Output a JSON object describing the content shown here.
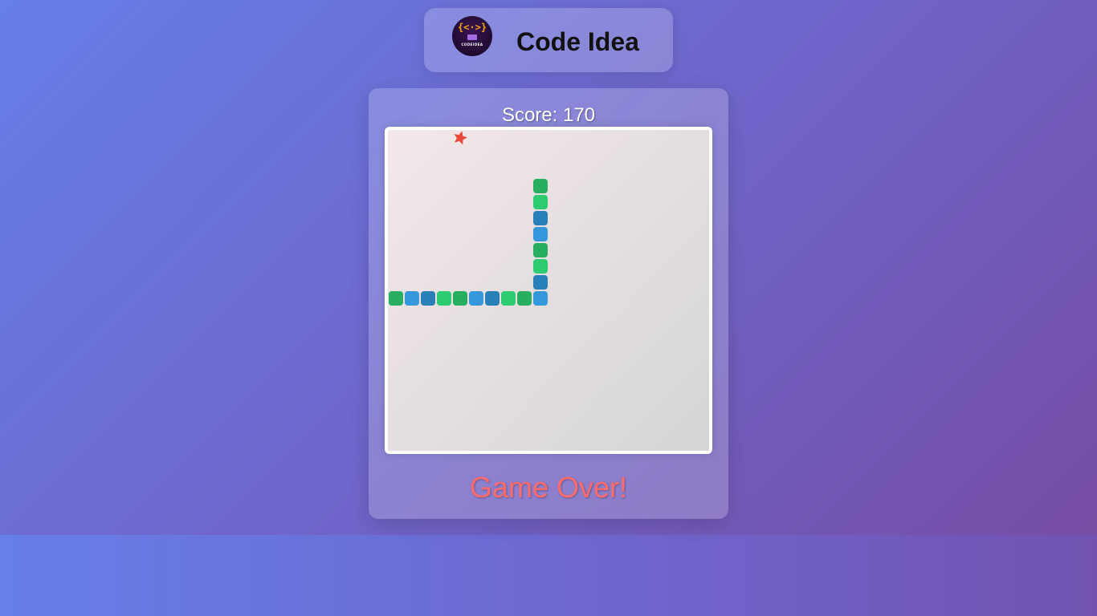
{
  "header": {
    "title": "Code Idea",
    "logo": {
      "mark": "{<·>}",
      "wordmark": "CODEIDEA"
    }
  },
  "game": {
    "score_label": "Score: 170",
    "status": "Game Over!",
    "grid_cells": 20,
    "food": {
      "col": 4,
      "row": 0,
      "color": "#e74c3c",
      "icon": "star-icon"
    },
    "snake": [
      {
        "col": 9,
        "row": 3,
        "color": "#27ae60"
      },
      {
        "col": 9,
        "row": 4,
        "color": "#2ecc71"
      },
      {
        "col": 9,
        "row": 5,
        "color": "#2980b9"
      },
      {
        "col": 9,
        "row": 6,
        "color": "#3498db"
      },
      {
        "col": 9,
        "row": 7,
        "color": "#27ae60"
      },
      {
        "col": 9,
        "row": 8,
        "color": "#2ecc71"
      },
      {
        "col": 9,
        "row": 9,
        "color": "#2980b9"
      },
      {
        "col": 9,
        "row": 10,
        "color": "#3498db"
      },
      {
        "col": 8,
        "row": 10,
        "color": "#27ae60"
      },
      {
        "col": 7,
        "row": 10,
        "color": "#2ecc71"
      },
      {
        "col": 6,
        "row": 10,
        "color": "#2980b9"
      },
      {
        "col": 5,
        "row": 10,
        "color": "#3498db"
      },
      {
        "col": 4,
        "row": 10,
        "color": "#27ae60"
      },
      {
        "col": 3,
        "row": 10,
        "color": "#2ecc71"
      },
      {
        "col": 2,
        "row": 10,
        "color": "#2980b9"
      },
      {
        "col": 1,
        "row": 10,
        "color": "#3498db"
      },
      {
        "col": 0,
        "row": 10,
        "color": "#27ae60"
      }
    ]
  }
}
